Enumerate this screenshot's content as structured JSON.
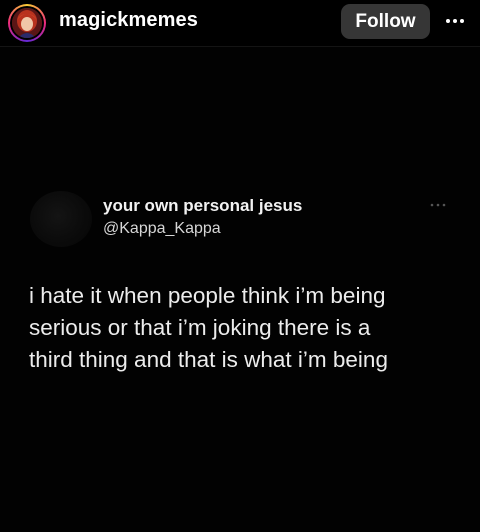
{
  "header": {
    "username": "magickmemes",
    "follow_label": "Follow",
    "avatar_icon": "user-avatar",
    "more_icon": "more-horizontal-icon"
  },
  "tweet": {
    "display_name": "your own personal jesus",
    "handle": "@Kappa_Kappa",
    "more_icon": "more-horizontal-icon",
    "text_lines": [
      "i hate it when people think i’m being",
      "serious or that i’m joking there is a",
      "third thing and that is what i’m being"
    ]
  },
  "colors": {
    "background": "#000000",
    "follow_button_bg": "#363636",
    "text": "#ffffff"
  }
}
